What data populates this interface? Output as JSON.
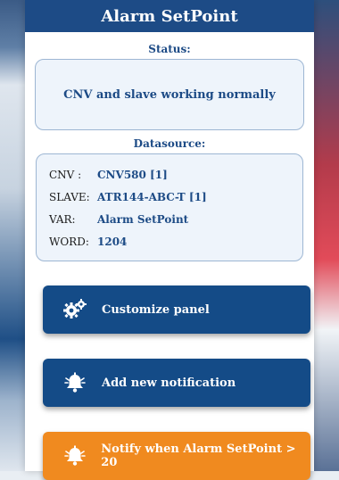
{
  "header": {
    "title": "Alarm SetPoint"
  },
  "status": {
    "label": "Status:",
    "message": "CNV and slave working normally"
  },
  "datasource": {
    "label": "Datasource:",
    "rows": [
      {
        "key": "CNV :",
        "value": "CNV580 [1]"
      },
      {
        "key": "SLAVE:",
        "value": "ATR144-ABC-T [1]"
      },
      {
        "key": "VAR:",
        "value": "Alarm SetPoint"
      },
      {
        "key": "WORD:",
        "value": "1204"
      }
    ]
  },
  "buttons": {
    "customize": {
      "label": "Customize panel",
      "icon": "gears-icon"
    },
    "add_notification": {
      "label": "Add new notification",
      "icon": "bell-icon"
    },
    "notify_rule": {
      "label": "Notify when Alarm SetPoint > 20",
      "icon": "bell-icon"
    }
  },
  "colors": {
    "primary": "#1d4b86",
    "button_blue": "#144b87",
    "button_orange": "#f08a1f"
  }
}
